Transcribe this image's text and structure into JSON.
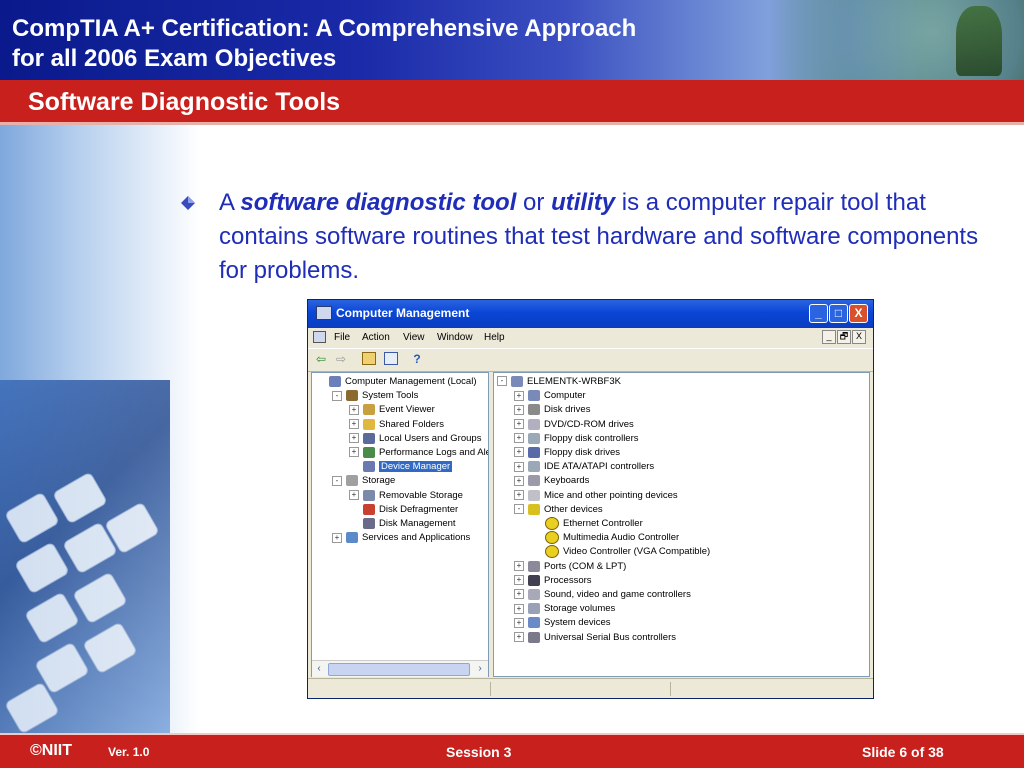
{
  "header": {
    "title_line1": "CompTIA A+ Certification: A Comprehensive Approach",
    "title_line2": "for all 2006 Exam Objectives",
    "section_title": "Software Diagnostic Tools"
  },
  "body": {
    "p_a": "A ",
    "p_term1": "software diagnostic tool",
    "p_or": " or ",
    "p_term2": "utility",
    "p_rest": " is a computer repair tool that contains software routines that test hardware and software components for problems."
  },
  "window": {
    "title": "Computer Management",
    "controls": [
      "_",
      "□",
      "X"
    ],
    "menu": [
      "File",
      "Action",
      "View",
      "Window",
      "Help"
    ],
    "mdi_controls": [
      "_",
      "🗗",
      "X"
    ],
    "left_tree": [
      {
        "label": "Computer Management (Local)",
        "level": 0,
        "expander": "",
        "icon": "computer-management-icon"
      },
      {
        "label": "System Tools",
        "level": 1,
        "expander": "-",
        "icon": "system-tools-icon"
      },
      {
        "label": "Event Viewer",
        "level": 2,
        "expander": "+",
        "icon": "event-viewer-icon"
      },
      {
        "label": "Shared Folders",
        "level": 2,
        "expander": "+",
        "icon": "shared-folders-icon"
      },
      {
        "label": "Local Users and Groups",
        "level": 2,
        "expander": "+",
        "icon": "users-icon"
      },
      {
        "label": "Performance Logs and Alerts",
        "level": 2,
        "expander": "+",
        "icon": "performance-icon"
      },
      {
        "label": "Device Manager",
        "level": 2,
        "expander": "",
        "icon": "device-manager-icon",
        "selected": true
      },
      {
        "label": "Storage",
        "level": 1,
        "expander": "-",
        "icon": "storage-icon"
      },
      {
        "label": "Removable Storage",
        "level": 2,
        "expander": "+",
        "icon": "removable-storage-icon"
      },
      {
        "label": "Disk Defragmenter",
        "level": 2,
        "expander": "",
        "icon": "defrag-icon"
      },
      {
        "label": "Disk Management",
        "level": 2,
        "expander": "",
        "icon": "disk-management-icon"
      },
      {
        "label": "Services and Applications",
        "level": 1,
        "expander": "+",
        "icon": "services-icon"
      }
    ],
    "right_tree": [
      {
        "label": "ELEMENTK-WRBF3K",
        "level": 0,
        "expander": "-",
        "icon": "computer-icon"
      },
      {
        "label": "Computer",
        "level": 1,
        "expander": "+",
        "icon": "computer-icon"
      },
      {
        "label": "Disk drives",
        "level": 1,
        "expander": "+",
        "icon": "disk-icon"
      },
      {
        "label": "DVD/CD-ROM drives",
        "level": 1,
        "expander": "+",
        "icon": "cdrom-icon"
      },
      {
        "label": "Floppy disk controllers",
        "level": 1,
        "expander": "+",
        "icon": "controller-icon"
      },
      {
        "label": "Floppy disk drives",
        "level": 1,
        "expander": "+",
        "icon": "floppy-icon"
      },
      {
        "label": "IDE ATA/ATAPI controllers",
        "level": 1,
        "expander": "+",
        "icon": "controller-icon"
      },
      {
        "label": "Keyboards",
        "level": 1,
        "expander": "+",
        "icon": "keyboard-icon"
      },
      {
        "label": "Mice and other pointing devices",
        "level": 1,
        "expander": "+",
        "icon": "mouse-icon"
      },
      {
        "label": "Other devices",
        "level": 1,
        "expander": "-",
        "icon": "unknown-device-icon"
      },
      {
        "label": "Ethernet Controller",
        "level": 2,
        "expander": "",
        "icon": "warning-icon"
      },
      {
        "label": "Multimedia Audio Controller",
        "level": 2,
        "expander": "",
        "icon": "warning-icon"
      },
      {
        "label": "Video Controller (VGA Compatible)",
        "level": 2,
        "expander": "",
        "icon": "warning-icon"
      },
      {
        "label": "Ports (COM & LPT)",
        "level": 1,
        "expander": "+",
        "icon": "port-icon"
      },
      {
        "label": "Processors",
        "level": 1,
        "expander": "+",
        "icon": "processor-icon"
      },
      {
        "label": "Sound, video and game controllers",
        "level": 1,
        "expander": "+",
        "icon": "sound-icon"
      },
      {
        "label": "Storage volumes",
        "level": 1,
        "expander": "+",
        "icon": "storage-volume-icon"
      },
      {
        "label": "System devices",
        "level": 1,
        "expander": "+",
        "icon": "system-device-icon"
      },
      {
        "label": "Universal Serial Bus controllers",
        "level": 1,
        "expander": "+",
        "icon": "usb-icon"
      }
    ],
    "colors": {
      "titlebar": "#0a46d6",
      "selection": "#316ac5",
      "chrome": "#ece9d8"
    }
  },
  "footer": {
    "logo": "©NIIT",
    "version": "Ver.  1.0",
    "session": "Session 3",
    "slide": "Slide 6 of 38"
  },
  "colors": {
    "header_blue": "#0a1a8c",
    "section_red": "#c8201c",
    "body_text": "#1f2db8"
  }
}
